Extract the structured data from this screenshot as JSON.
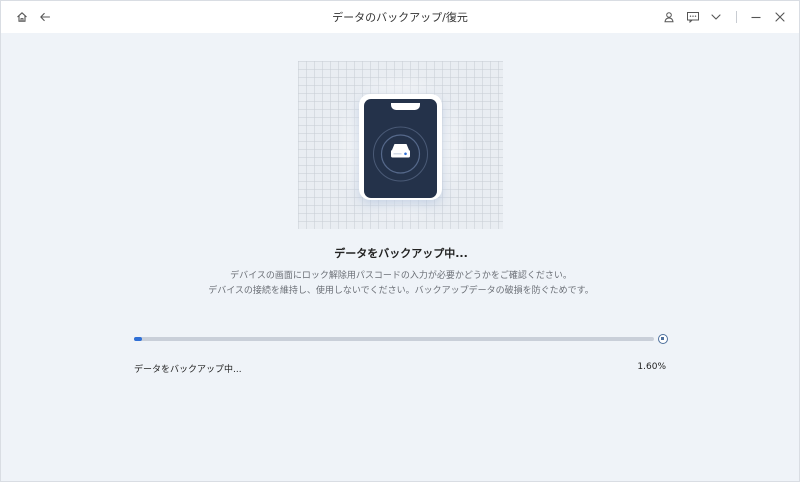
{
  "window": {
    "title": "データのバックアップ/復元"
  },
  "titlebar": {
    "left_icons": [
      "home-icon",
      "back-arrow-icon"
    ],
    "right_icons": [
      "user-icon",
      "feedback-icon",
      "chevron-down-icon",
      "minimize-icon",
      "close-icon"
    ]
  },
  "illustration": {
    "icon": "phone-with-drive-icon"
  },
  "main": {
    "heading": "データをバックアップ中...",
    "description_line1": "デバイスの画面にロック解除用パスコードの入力が必要かどうかをご確認ください。",
    "description_line2": "デバイスの接続を維持し、使用しないでください。バックアップデータの破損を防ぐためです。"
  },
  "progress": {
    "status_label": "データをバックアップ中...",
    "percent_text": "1.60%",
    "percent_value": 1.6,
    "fill_color": "#2f6fd6",
    "stop_icon": "stop-icon"
  }
}
